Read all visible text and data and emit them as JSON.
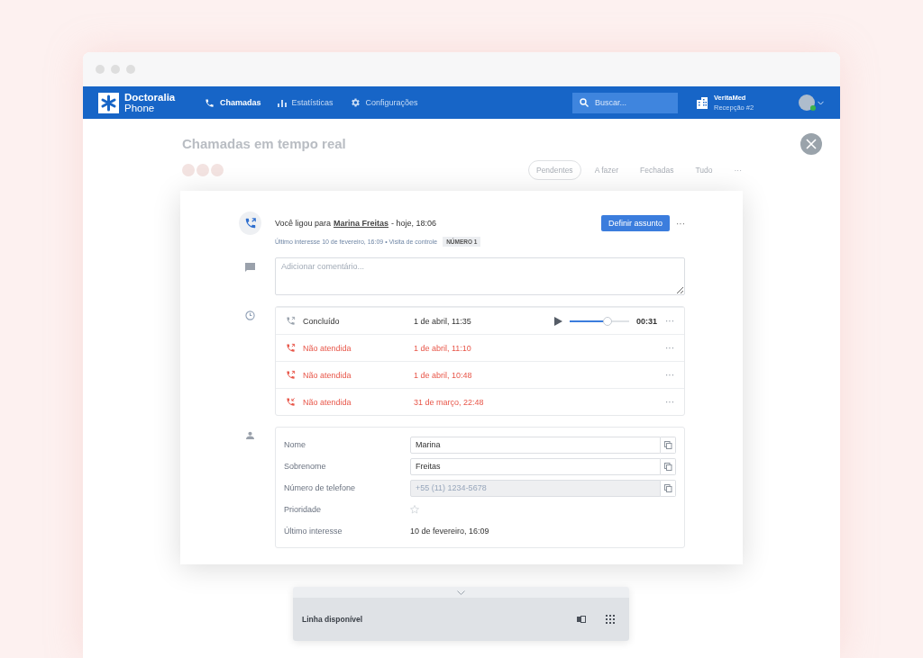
{
  "nav": {
    "logo": {
      "title": "Doctoralia",
      "subtitle": "Phone"
    },
    "tabs": [
      {
        "kind": "phone",
        "label": "Chamadas",
        "selected": true
      },
      {
        "kind": "chart",
        "label": "Estatísticas",
        "selected": false
      },
      {
        "kind": "gear",
        "label": "Configurações",
        "selected": false
      }
    ],
    "search": {
      "placeholder": "Buscar..."
    },
    "clinic": {
      "name": "VeritaMed",
      "location": "Recepção #2"
    },
    "user": {
      "online": true
    }
  },
  "background": {
    "title": "Chamadas em tempo real",
    "filters": [
      {
        "label": "Pendentes",
        "selected": true
      },
      {
        "label": "A fazer",
        "selected": false
      },
      {
        "label": "Fechadas",
        "selected": false
      },
      {
        "label": "Tudo",
        "selected": false
      },
      {
        "label": "···",
        "selected": false
      }
    ]
  },
  "call": {
    "prefix": "Você ligou para",
    "contact": "Marina Freitas",
    "suffix": "- hoje, 18:06",
    "button": "Definir assunto",
    "more": "···",
    "meta": "Último interesse 10 de fevereiro, 16:09 • Visita de controle",
    "tag": "NÚMERO 1",
    "comment": {
      "placeholder": "Adicionar comentário..."
    }
  },
  "history": [
    {
      "kind": "outgoing",
      "missed": false,
      "status": "Concluído",
      "date": "1 de abril, 11:35",
      "player": {
        "level": 0.63,
        "time": "00:31"
      },
      "more": "···"
    },
    {
      "kind": "outgoing",
      "missed": true,
      "status": "Não atendida",
      "date": "1 de abril, 11:10",
      "more": "···"
    },
    {
      "kind": "outgoing",
      "missed": true,
      "status": "Não atendida",
      "date": "1 de abril, 10:48",
      "more": "···"
    },
    {
      "kind": "incoming",
      "missed": true,
      "status": "Não atendida",
      "date": "31 de março, 22:48",
      "more": "···"
    }
  ],
  "contact": {
    "fields": [
      {
        "kind": "input",
        "label": "Nome",
        "value": "Marina",
        "disabled": false
      },
      {
        "kind": "input",
        "label": "Sobrenome",
        "value": "Freitas",
        "disabled": false
      },
      {
        "kind": "input",
        "label": "Número de telefone",
        "value": "+55 (11) 1234-5678",
        "disabled": true
      },
      {
        "kind": "star",
        "label": "Prioridade",
        "checked": false
      },
      {
        "kind": "text",
        "label": "Último interesse",
        "value": "10 de fevereiro, 16:09"
      }
    ]
  },
  "dialer": {
    "status": "Linha disponível"
  }
}
